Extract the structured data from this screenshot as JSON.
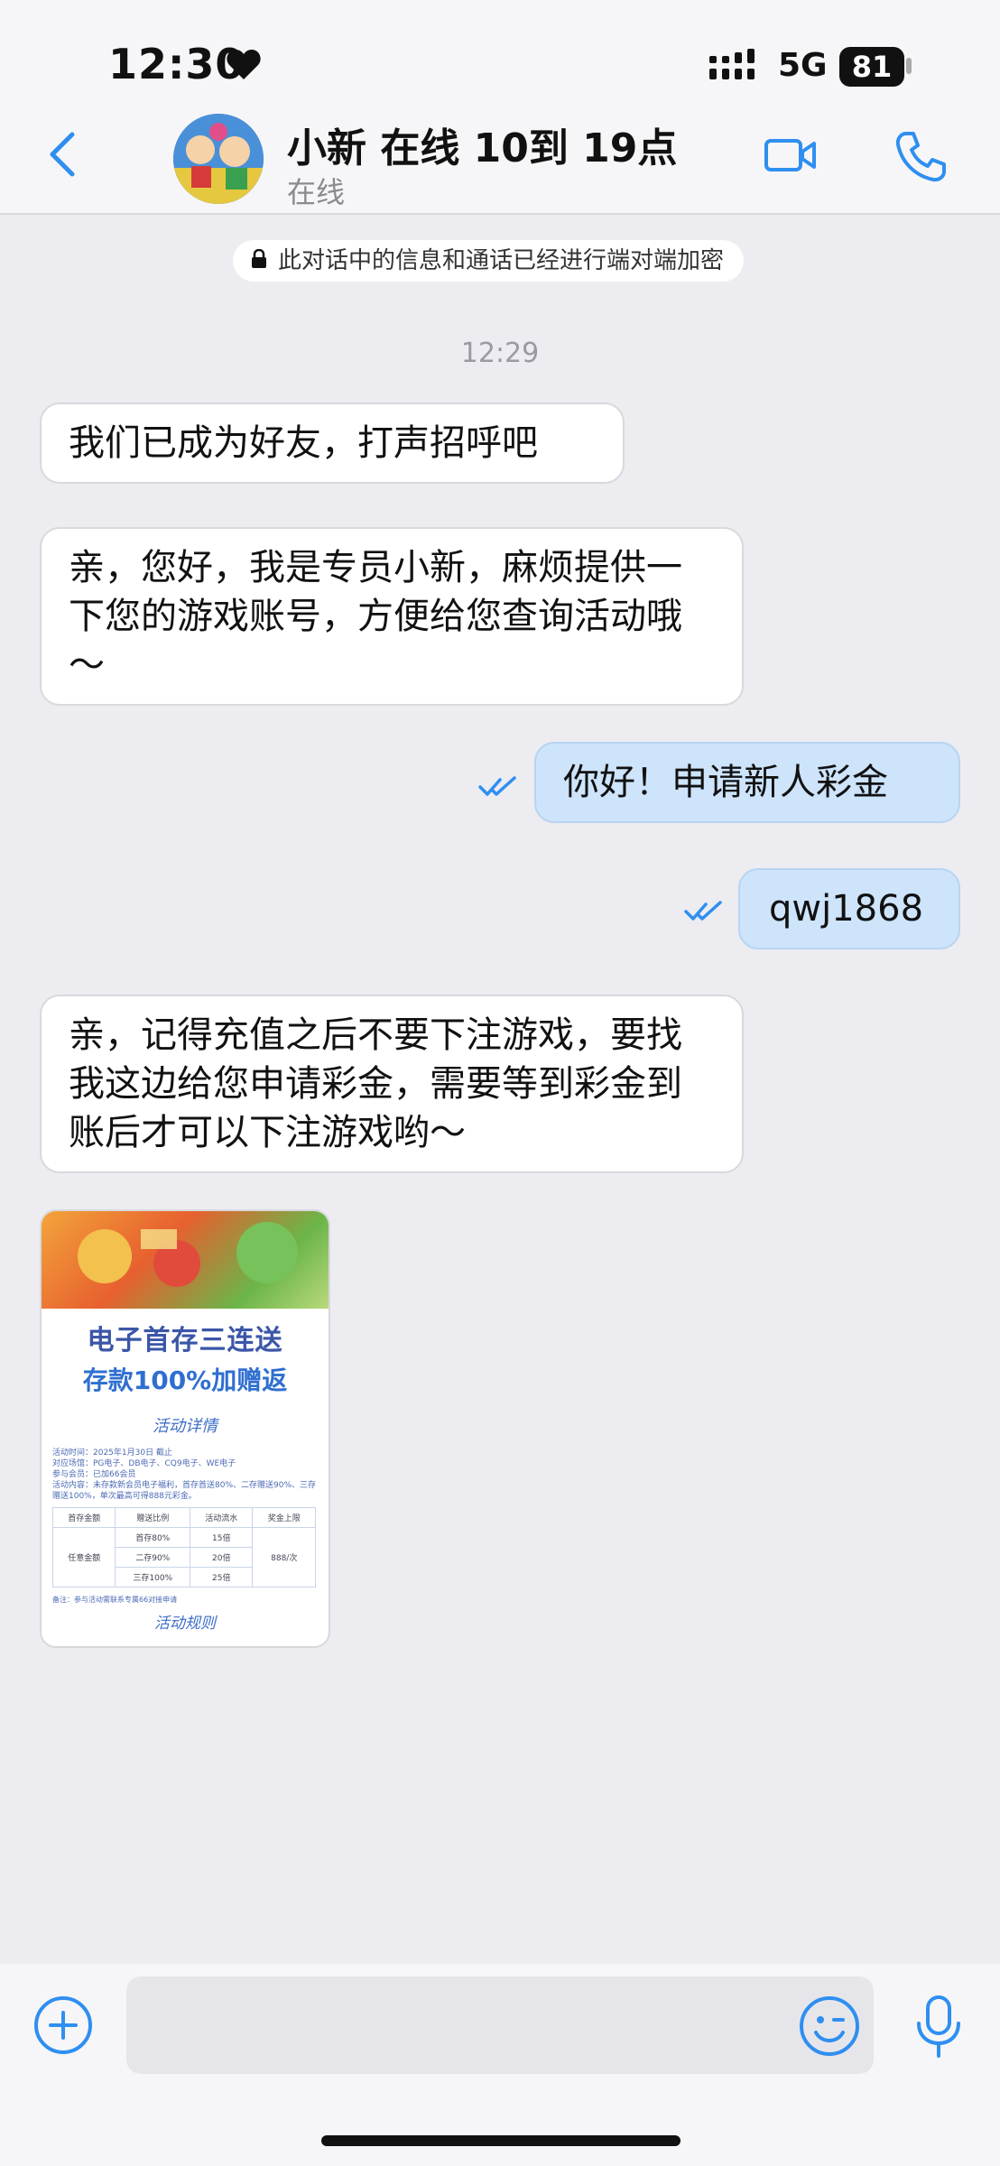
{
  "status_bar": {
    "time": "12:30",
    "network": "5G",
    "battery": "81"
  },
  "header": {
    "title": "小新 在线 10到 19点",
    "status": "在线"
  },
  "chat": {
    "encryption_notice": "此对话中的信息和通话已经进行端对端加密",
    "timestamp": "12:29",
    "messages": [
      {
        "direction": "in",
        "text": "我们已成为好友，打声招呼吧"
      },
      {
        "direction": "in",
        "text": "亲，您好，我是专员小新，麻烦提供一下您的游戏账号，方便给您查询活动哦～"
      },
      {
        "direction": "out",
        "text": "你好！申请新人彩金"
      },
      {
        "direction": "out",
        "text": "qwj1868"
      },
      {
        "direction": "in",
        "text": "亲，记得充值之后不要下注游戏，要找我这边给您申请彩金，需要等到彩金到账后才可以下注游戏哟～"
      }
    ],
    "image_card": {
      "headline": "电子首存三连送",
      "subheadline": "存款100%加赠返",
      "section_title": "活动详情",
      "details": [
        "活动时间：2025年1月30日 截止",
        "对应场馆：PG电子、DB电子、CQ9电子、WE电子",
        "参与会员：已加66会员",
        "活动内容：未存款新会员电子福利，首存首送80%、二存赠送90%、三存赠送100%，单次最高可得888元彩金。"
      ],
      "table": {
        "headers": [
          "首存金额",
          "赠送比例",
          "活动流水",
          "奖金上限"
        ],
        "amount_label": "任意金额",
        "rows": [
          {
            "ratio": "首存80%",
            "turnover": "15倍"
          },
          {
            "ratio": "二存90%",
            "turnover": "20倍"
          },
          {
            "ratio": "三存100%",
            "turnover": "25倍"
          }
        ],
        "cap": "888/次"
      },
      "note": "备注：参与活动需联系专属66对接申请",
      "footer": "活动规则"
    }
  },
  "icons": [
    "back-chevron-icon",
    "video-call-icon",
    "phone-call-icon",
    "lock-icon",
    "double-check-icon",
    "plus-icon",
    "emoji-icon",
    "microphone-icon"
  ],
  "colors": {
    "accent": "#2f8ff0",
    "outgoing_bubble": "#cde4fb",
    "background": "#ececf1"
  }
}
